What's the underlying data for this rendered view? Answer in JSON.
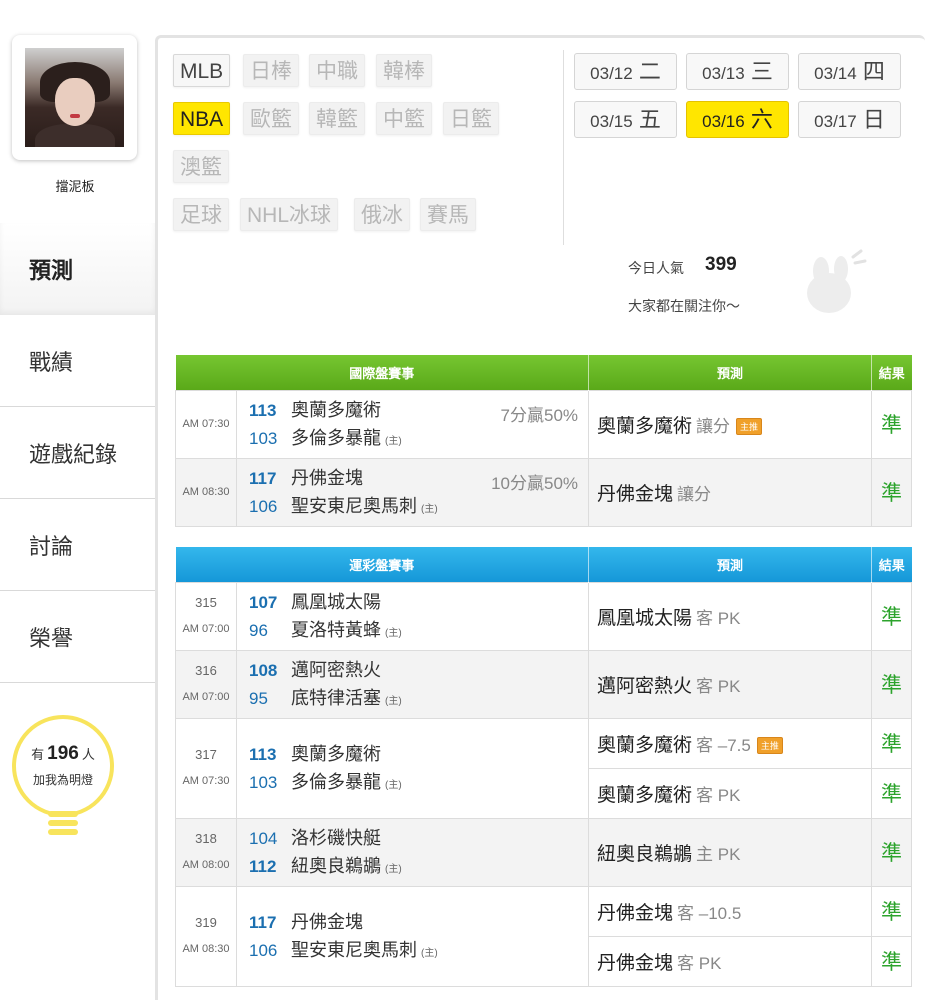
{
  "profile": {
    "nickname": "擋泥板"
  },
  "nav": [
    "預測",
    "戰績",
    "遊戲紀錄",
    "討論",
    "榮譽"
  ],
  "bulb": {
    "prefix": "有",
    "count": "196",
    "suffix": "人",
    "text": "加我為明燈"
  },
  "leagues": {
    "row1": [
      "MLB",
      "日棒",
      "中職",
      "韓棒"
    ],
    "row2": [
      "NBA",
      "歐籃",
      "韓籃",
      "中籃",
      "日籃"
    ],
    "row3": [
      "澳籃"
    ],
    "row4": [
      "足球",
      "NHL冰球",
      "俄冰",
      "賽馬"
    ]
  },
  "dates": [
    {
      "md": "03/12",
      "day": "二"
    },
    {
      "md": "03/13",
      "day": "三"
    },
    {
      "md": "03/14",
      "day": "四"
    },
    {
      "md": "03/15",
      "day": "五"
    },
    {
      "md": "03/16",
      "day": "六"
    },
    {
      "md": "03/17",
      "day": "日"
    }
  ],
  "popularity": {
    "label": "今日人氣",
    "value": "399",
    "sub": "大家都在關注你～"
  },
  "intl": {
    "headers": [
      "國際盤賽事",
      "預測",
      "結果"
    ],
    "rows": [
      {
        "time": "AM 07:30",
        "s1": "113",
        "t1": "奧蘭多魔術",
        "s2": "103",
        "t2": "多倫多暴龍",
        "host": "(主)",
        "spread": "7分贏50%",
        "pred": "奧蘭多魔術",
        "meta": "讓分",
        "badge": "主推",
        "result": "準"
      },
      {
        "time": "AM 08:30",
        "s1": "117",
        "t1": "丹佛金塊",
        "s2": "106",
        "t2": "聖安東尼奧馬刺",
        "host": "(主)",
        "spread": "10分贏50%",
        "pred": "丹佛金塊",
        "meta": "讓分",
        "result": "準"
      }
    ]
  },
  "lottery": {
    "headers": [
      "運彩盤賽事",
      "預測",
      "結果"
    ],
    "rows": [
      {
        "num": "315",
        "time": "AM 07:00",
        "s1": "107",
        "t1": "鳳凰城太陽",
        "s2": "96",
        "t2": "夏洛特黃蜂",
        "host": "(主)",
        "preds": [
          {
            "team": "鳳凰城太陽",
            "meta": "客 PK",
            "result": "準"
          }
        ]
      },
      {
        "num": "316",
        "time": "AM 07:00",
        "s1": "108",
        "t1": "邁阿密熱火",
        "s2": "95",
        "t2": "底特律活塞",
        "host": "(主)",
        "preds": [
          {
            "team": "邁阿密熱火",
            "meta": "客 PK",
            "result": "準"
          }
        ]
      },
      {
        "num": "317",
        "time": "AM 07:30",
        "s1": "113",
        "t1": "奧蘭多魔術",
        "s2": "103",
        "t2": "多倫多暴龍",
        "host": "(主)",
        "preds": [
          {
            "team": "奧蘭多魔術",
            "meta": "客 –7.5",
            "badge": "主推",
            "result": "準"
          },
          {
            "team": "奧蘭多魔術",
            "meta": "客 PK",
            "result": "準"
          }
        ]
      },
      {
        "num": "318",
        "time": "AM 08:00",
        "s1": "104",
        "t1": "洛杉磯快艇",
        "s2": "112",
        "t2": "紐奧良鵜鶘",
        "host": "(主)",
        "preds": [
          {
            "team": "紐奧良鵜鶘",
            "meta": "主 PK",
            "result": "準"
          }
        ]
      },
      {
        "num": "319",
        "time": "AM 08:30",
        "s1": "117",
        "t1": "丹佛金塊",
        "s2": "106",
        "t2": "聖安東尼奧馬刺",
        "host": "(主)",
        "preds": [
          {
            "team": "丹佛金塊",
            "meta": "客 –10.5",
            "result": "準"
          },
          {
            "team": "丹佛金塊",
            "meta": "客 PK",
            "result": "準"
          }
        ]
      }
    ]
  },
  "colors": {
    "green_header": "#5aa919",
    "blue_header": "#1597d8",
    "selected": "#ffe600",
    "result": "#2ca32c",
    "score": "#1b6fb0"
  }
}
